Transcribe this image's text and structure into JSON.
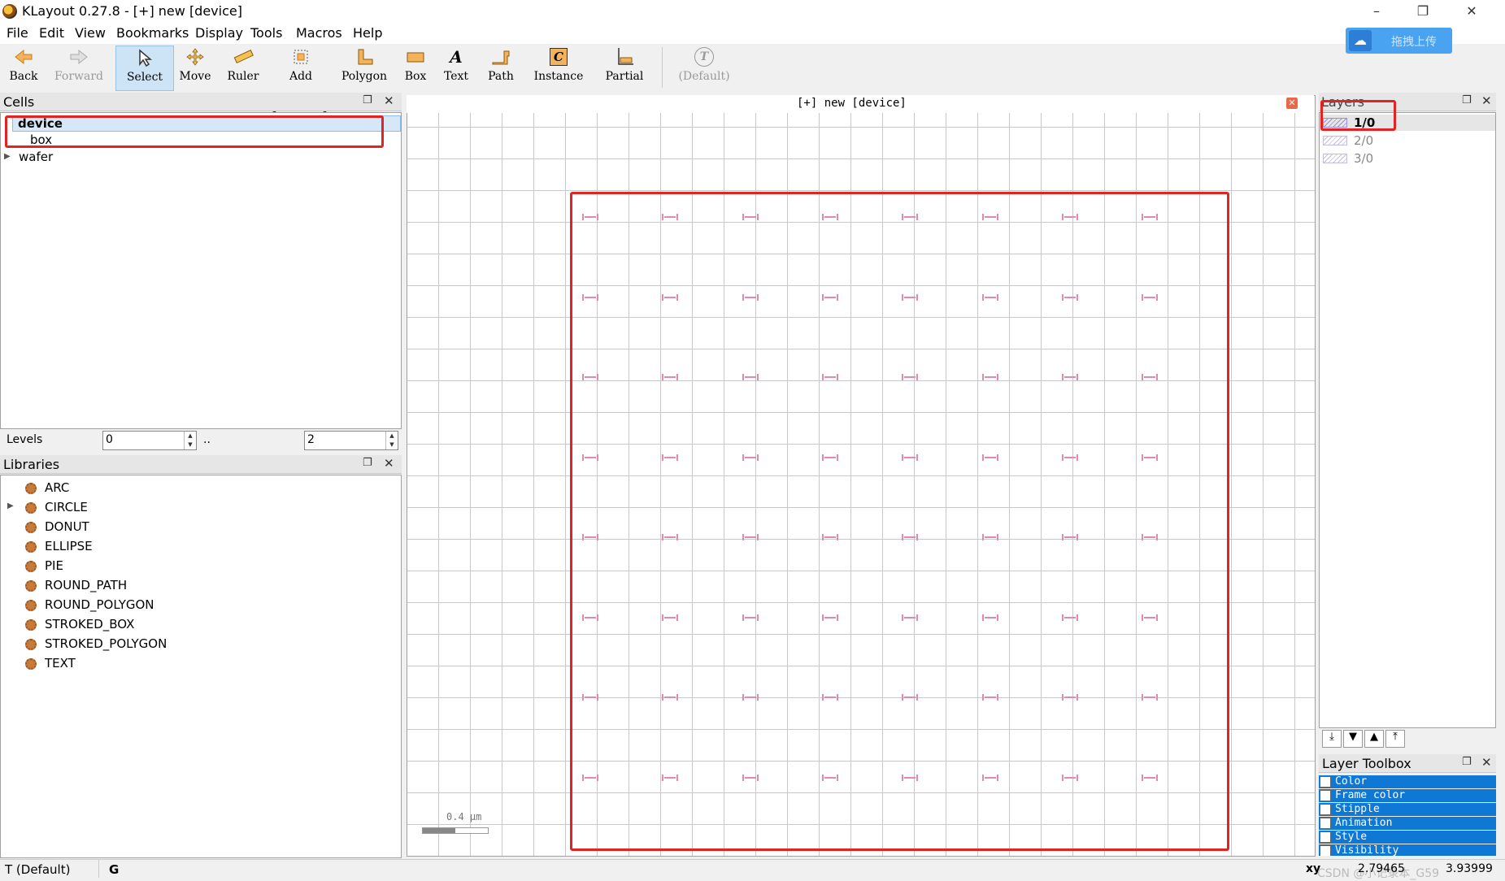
{
  "window": {
    "title": "KLayout 0.27.8 - [+] new [device]",
    "minimize": "–",
    "restore": "❐",
    "close": "✕"
  },
  "menu": [
    "File",
    "Edit",
    "View",
    "Bookmarks",
    "Display",
    "Tools",
    "Macros",
    "Help"
  ],
  "toolbar": {
    "back": "Back",
    "forward": "Forward",
    "select": "Select",
    "move": "Move",
    "ruler": "Ruler",
    "add": "Add",
    "polygon": "Polygon",
    "box": "Box",
    "text": "Text",
    "path": "Path",
    "instance": "Instance",
    "partial": "Partial",
    "default": "(Default)"
  },
  "upload_button": "拖拽上传",
  "cells": {
    "title": "Cells",
    "items": [
      {
        "label": "device"
      },
      {
        "label": "box"
      },
      {
        "label": "wafer"
      }
    ],
    "levels_label": "Levels",
    "level_from": "0",
    "level_sep": "..",
    "level_to": "2"
  },
  "libraries": {
    "title": "Libraries",
    "items": [
      "ARC",
      "CIRCLE",
      "DONUT",
      "ELLIPSE",
      "PIE",
      "ROUND_PATH",
      "ROUND_POLYGON",
      "STROKED_BOX",
      "STROKED_POLYGON",
      "TEXT"
    ]
  },
  "canvas": {
    "title": "[+] new [device]",
    "scale_label": "0.4 µm"
  },
  "layers": {
    "title": "Layers",
    "items": [
      "1/0",
      "2/0",
      "3/0"
    ],
    "swatch_color": "#9b8fd6"
  },
  "layer_toolbox": {
    "title": "Layer Toolbox",
    "rows": [
      "Color",
      "Frame color",
      "Stipple",
      "Animation",
      "Style",
      "Visibility"
    ]
  },
  "status": {
    "mode": "T (Default)",
    "grid": "G",
    "xy_label": "xy",
    "x": "2.79465",
    "y": "3.93999",
    "watermark": "CSDN @小记录本_G59"
  },
  "colors": {
    "highlight": "#e02424",
    "shape": "#e08ab0",
    "toolbox_row": "#0f78d4"
  }
}
